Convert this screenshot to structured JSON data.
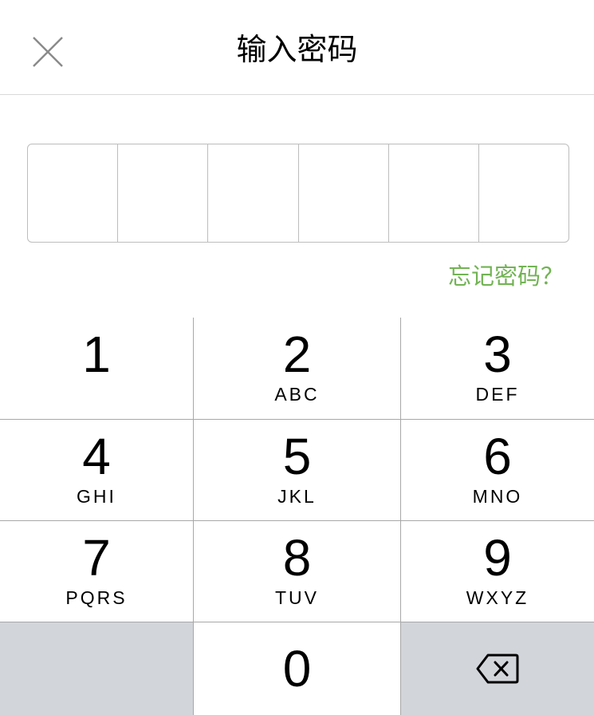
{
  "header": {
    "title": "输入密码",
    "close_icon": "close-icon"
  },
  "pin": {
    "length": 6,
    "entered": 0
  },
  "forgot_link": "忘记密码？",
  "colors": {
    "accent": "#72b354",
    "function_key_bg": "#d2d5da",
    "divider": "#a8a8a8"
  },
  "keypad": {
    "keys": [
      {
        "digit": "1",
        "letters": ""
      },
      {
        "digit": "2",
        "letters": "ABC"
      },
      {
        "digit": "3",
        "letters": "DEF"
      },
      {
        "digit": "4",
        "letters": "GHI"
      },
      {
        "digit": "5",
        "letters": "JKL"
      },
      {
        "digit": "6",
        "letters": "MNO"
      },
      {
        "digit": "7",
        "letters": "PQRS"
      },
      {
        "digit": "8",
        "letters": "TUV"
      },
      {
        "digit": "9",
        "letters": "WXYZ"
      },
      {
        "digit": "0",
        "letters": ""
      }
    ],
    "backspace_icon": "backspace-icon"
  }
}
